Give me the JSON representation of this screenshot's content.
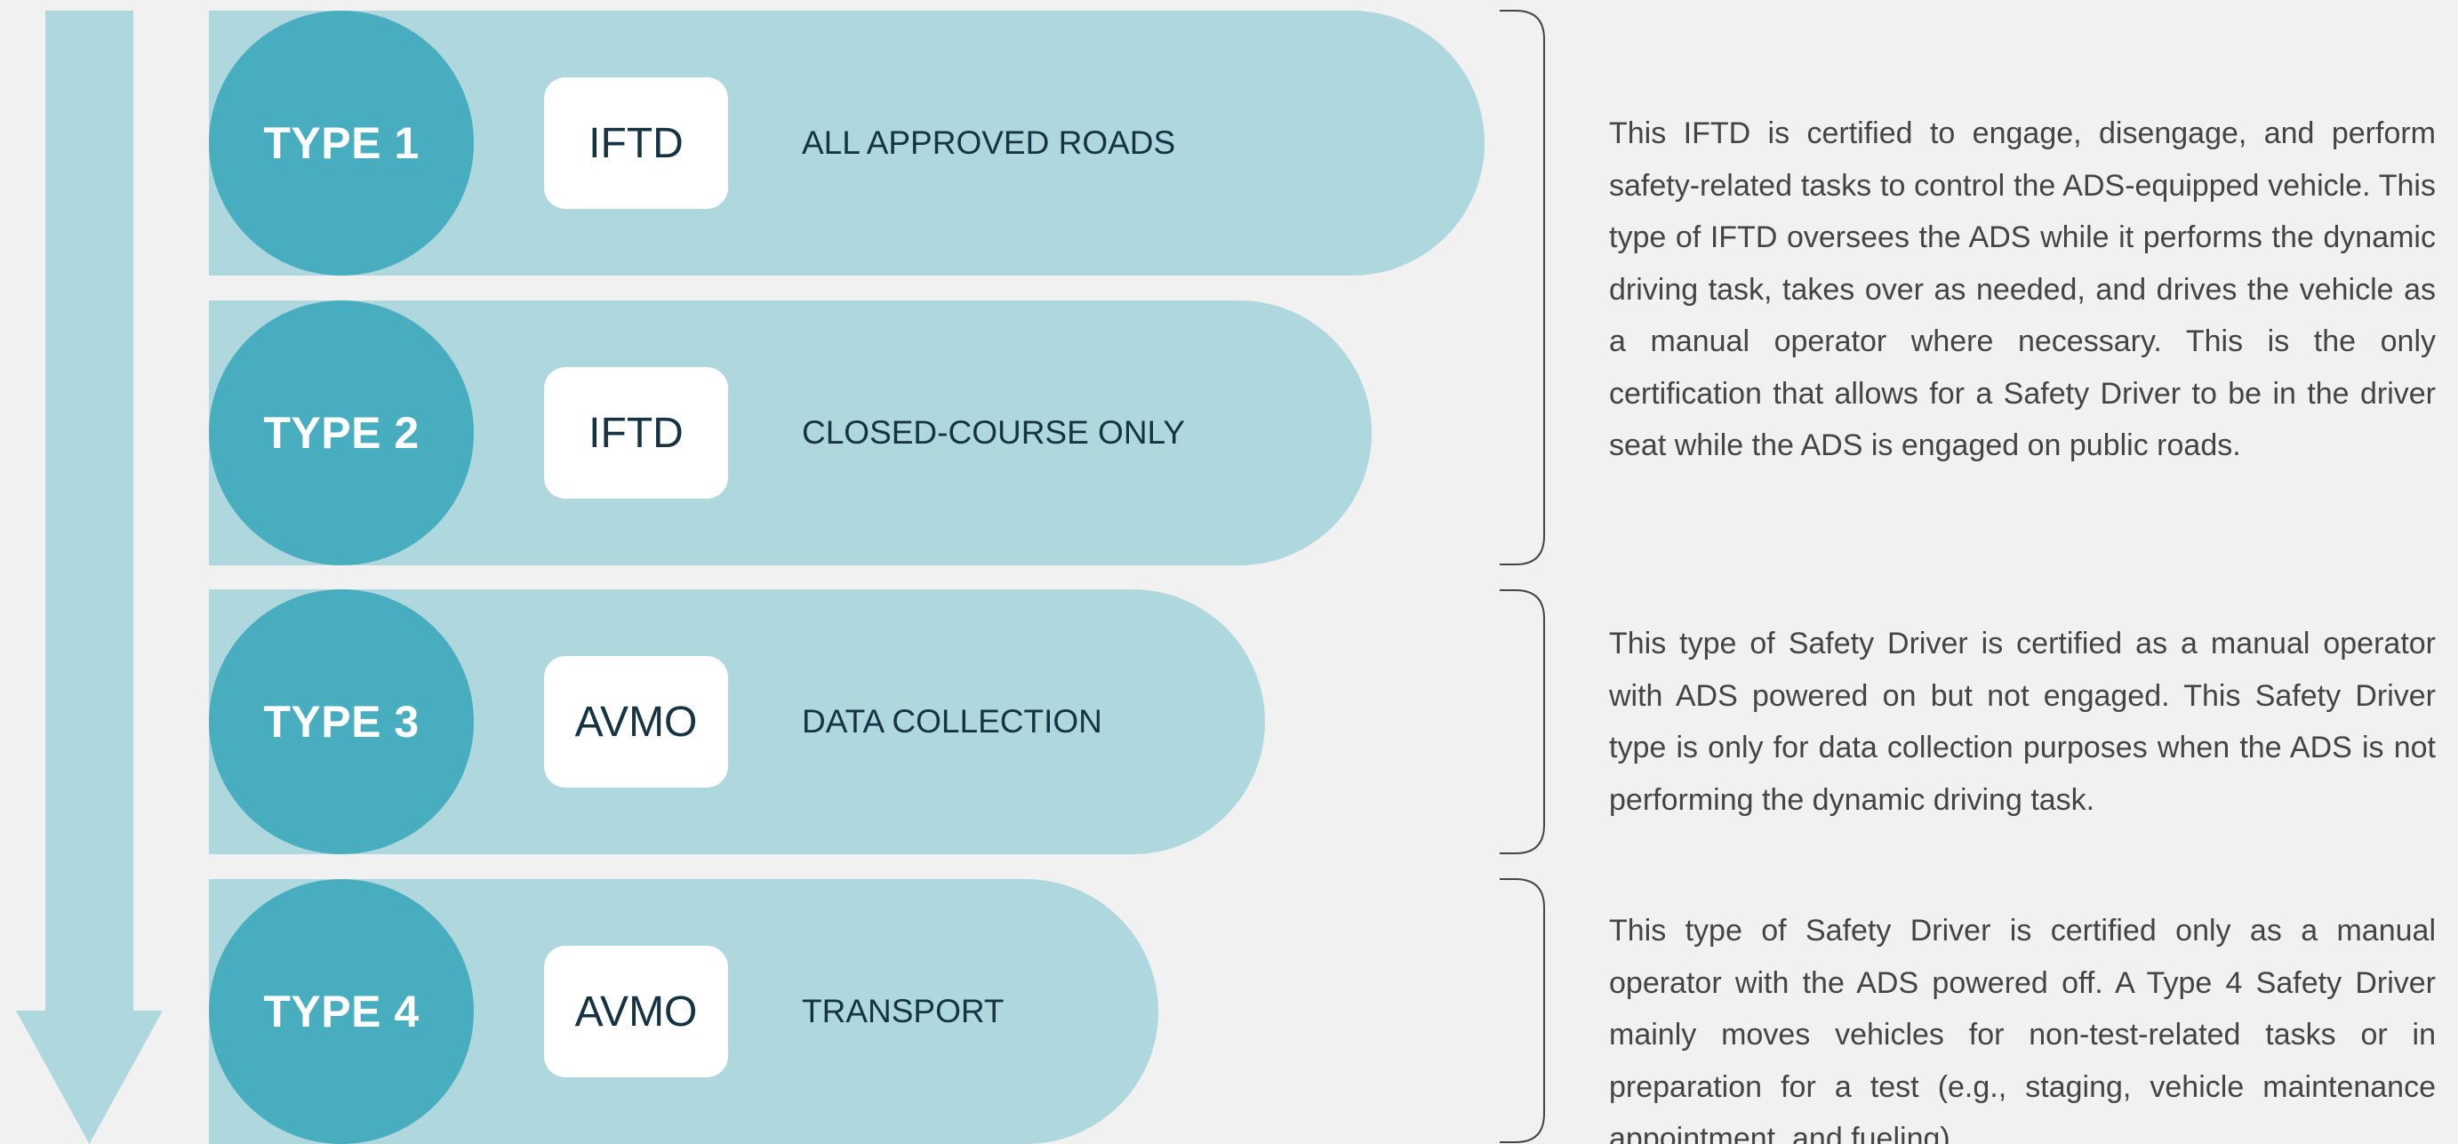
{
  "colors": {
    "background": "#f1f1f1",
    "pill": "#afd8de",
    "circle": "#48adbf",
    "arrow": "#afd8de",
    "box": "#ffffff",
    "dark_text": "#153342",
    "body_text": "#444444",
    "brace": "#444444"
  },
  "icons": {
    "arrow": "down-arrow-icon"
  },
  "types": [
    {
      "label": "TYPE 1",
      "cert": "IFTD",
      "scope": "ALL APPROVED ROADS"
    },
    {
      "label": "TYPE 2",
      "cert": "IFTD",
      "scope": "CLOSED-COURSE ONLY"
    },
    {
      "label": "TYPE 3",
      "cert": "AVMO",
      "scope": "DATA COLLECTION"
    },
    {
      "label": "TYPE 4",
      "cert": "AVMO",
      "scope": "TRANSPORT"
    }
  ],
  "descriptions": [
    "This IFTD is certified to engage, disengage, and perform safety-related tasks to control the ADS-equipped vehicle. This type of IFTD oversees the ADS while it performs the dynamic driving task, takes over as needed, and drives the vehicle as a manual operator where necessary. This is the only certification that allows for a Safety Driver to be in the driver seat while the ADS is engaged on public roads.",
    "This type of Safety Driver is certified as a manual operator with ADS powered on but not engaged. This Safety Driver type is only for data collection purposes when the ADS is not performing the dynamic driving task.",
    "This type of Safety Driver is certified only as a manual operator with the ADS powered off. A Type 4 Safety Driver mainly moves vehicles for non-test-related tasks or in preparation for a test (e.g., staging, vehicle maintenance appointment, and fueling)."
  ]
}
